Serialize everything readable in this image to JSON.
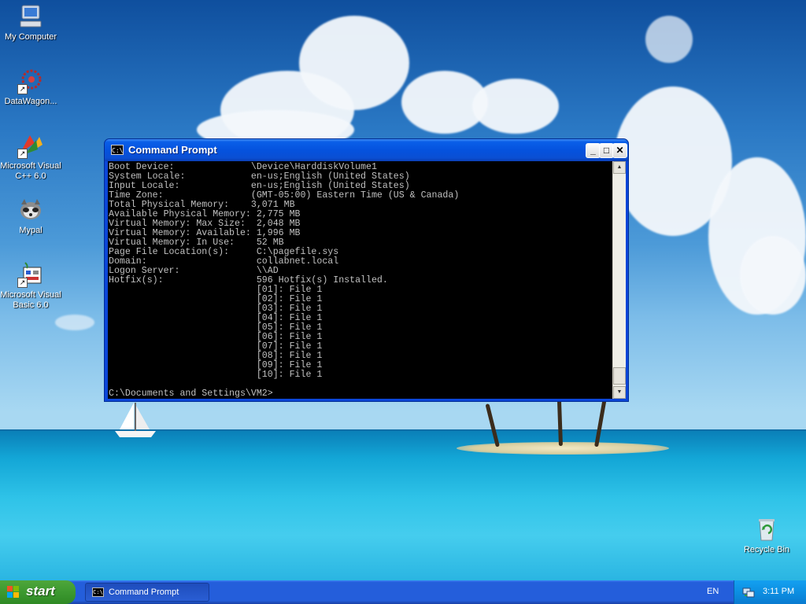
{
  "desktop": {
    "icons": [
      {
        "label": "My Computer",
        "icon": "my-computer-icon"
      },
      {
        "label": "DataWagon...",
        "icon": "datawagon-icon"
      },
      {
        "label": "Microsoft Visual C++ 6.0",
        "icon": "visual-cpp-icon"
      },
      {
        "label": "Mypal",
        "icon": "mypal-icon"
      },
      {
        "label": "Microsoft Visual Basic 6.0",
        "icon": "visual-basic-icon"
      },
      {
        "label": "Recycle Bin",
        "icon": "recycle-bin-icon"
      }
    ]
  },
  "window": {
    "title": "Command Prompt",
    "title_icon": "C:\\",
    "buttons": {
      "minimize": "_",
      "maximize": "□",
      "close": "✕"
    },
    "console_text": "Boot Device:              \\Device\\HarddiskVolume1\nSystem Locale:            en-us;English (United States)\nInput Locale:             en-us;English (United States)\nTime Zone:                (GMT-05:00) Eastern Time (US & Canada)\nTotal Physical Memory:    3,071 MB\nAvailable Physical Memory: 2,775 MB\nVirtual Memory: Max Size:  2,048 MB\nVirtual Memory: Available: 1,996 MB\nVirtual Memory: In Use:    52 MB\nPage File Location(s):     C:\\pagefile.sys\nDomain:                    collabnet.local\nLogon Server:              \\\\AD\nHotfix(s):                 596 Hotfix(s) Installed.\n                           [01]: File 1\n                           [02]: File 1\n                           [03]: File 1\n                           [04]: File 1\n                           [05]: File 1\n                           [06]: File 1\n                           [07]: File 1\n                           [08]: File 1\n                           [09]: File 1\n                           [10]: File 1\n\nC:\\Documents and Settings\\VM2>"
  },
  "taskbar": {
    "start_label": "start",
    "task_label": "Command Prompt",
    "task_icon": "C:\\",
    "language": "EN",
    "clock": "3:11 PM"
  }
}
